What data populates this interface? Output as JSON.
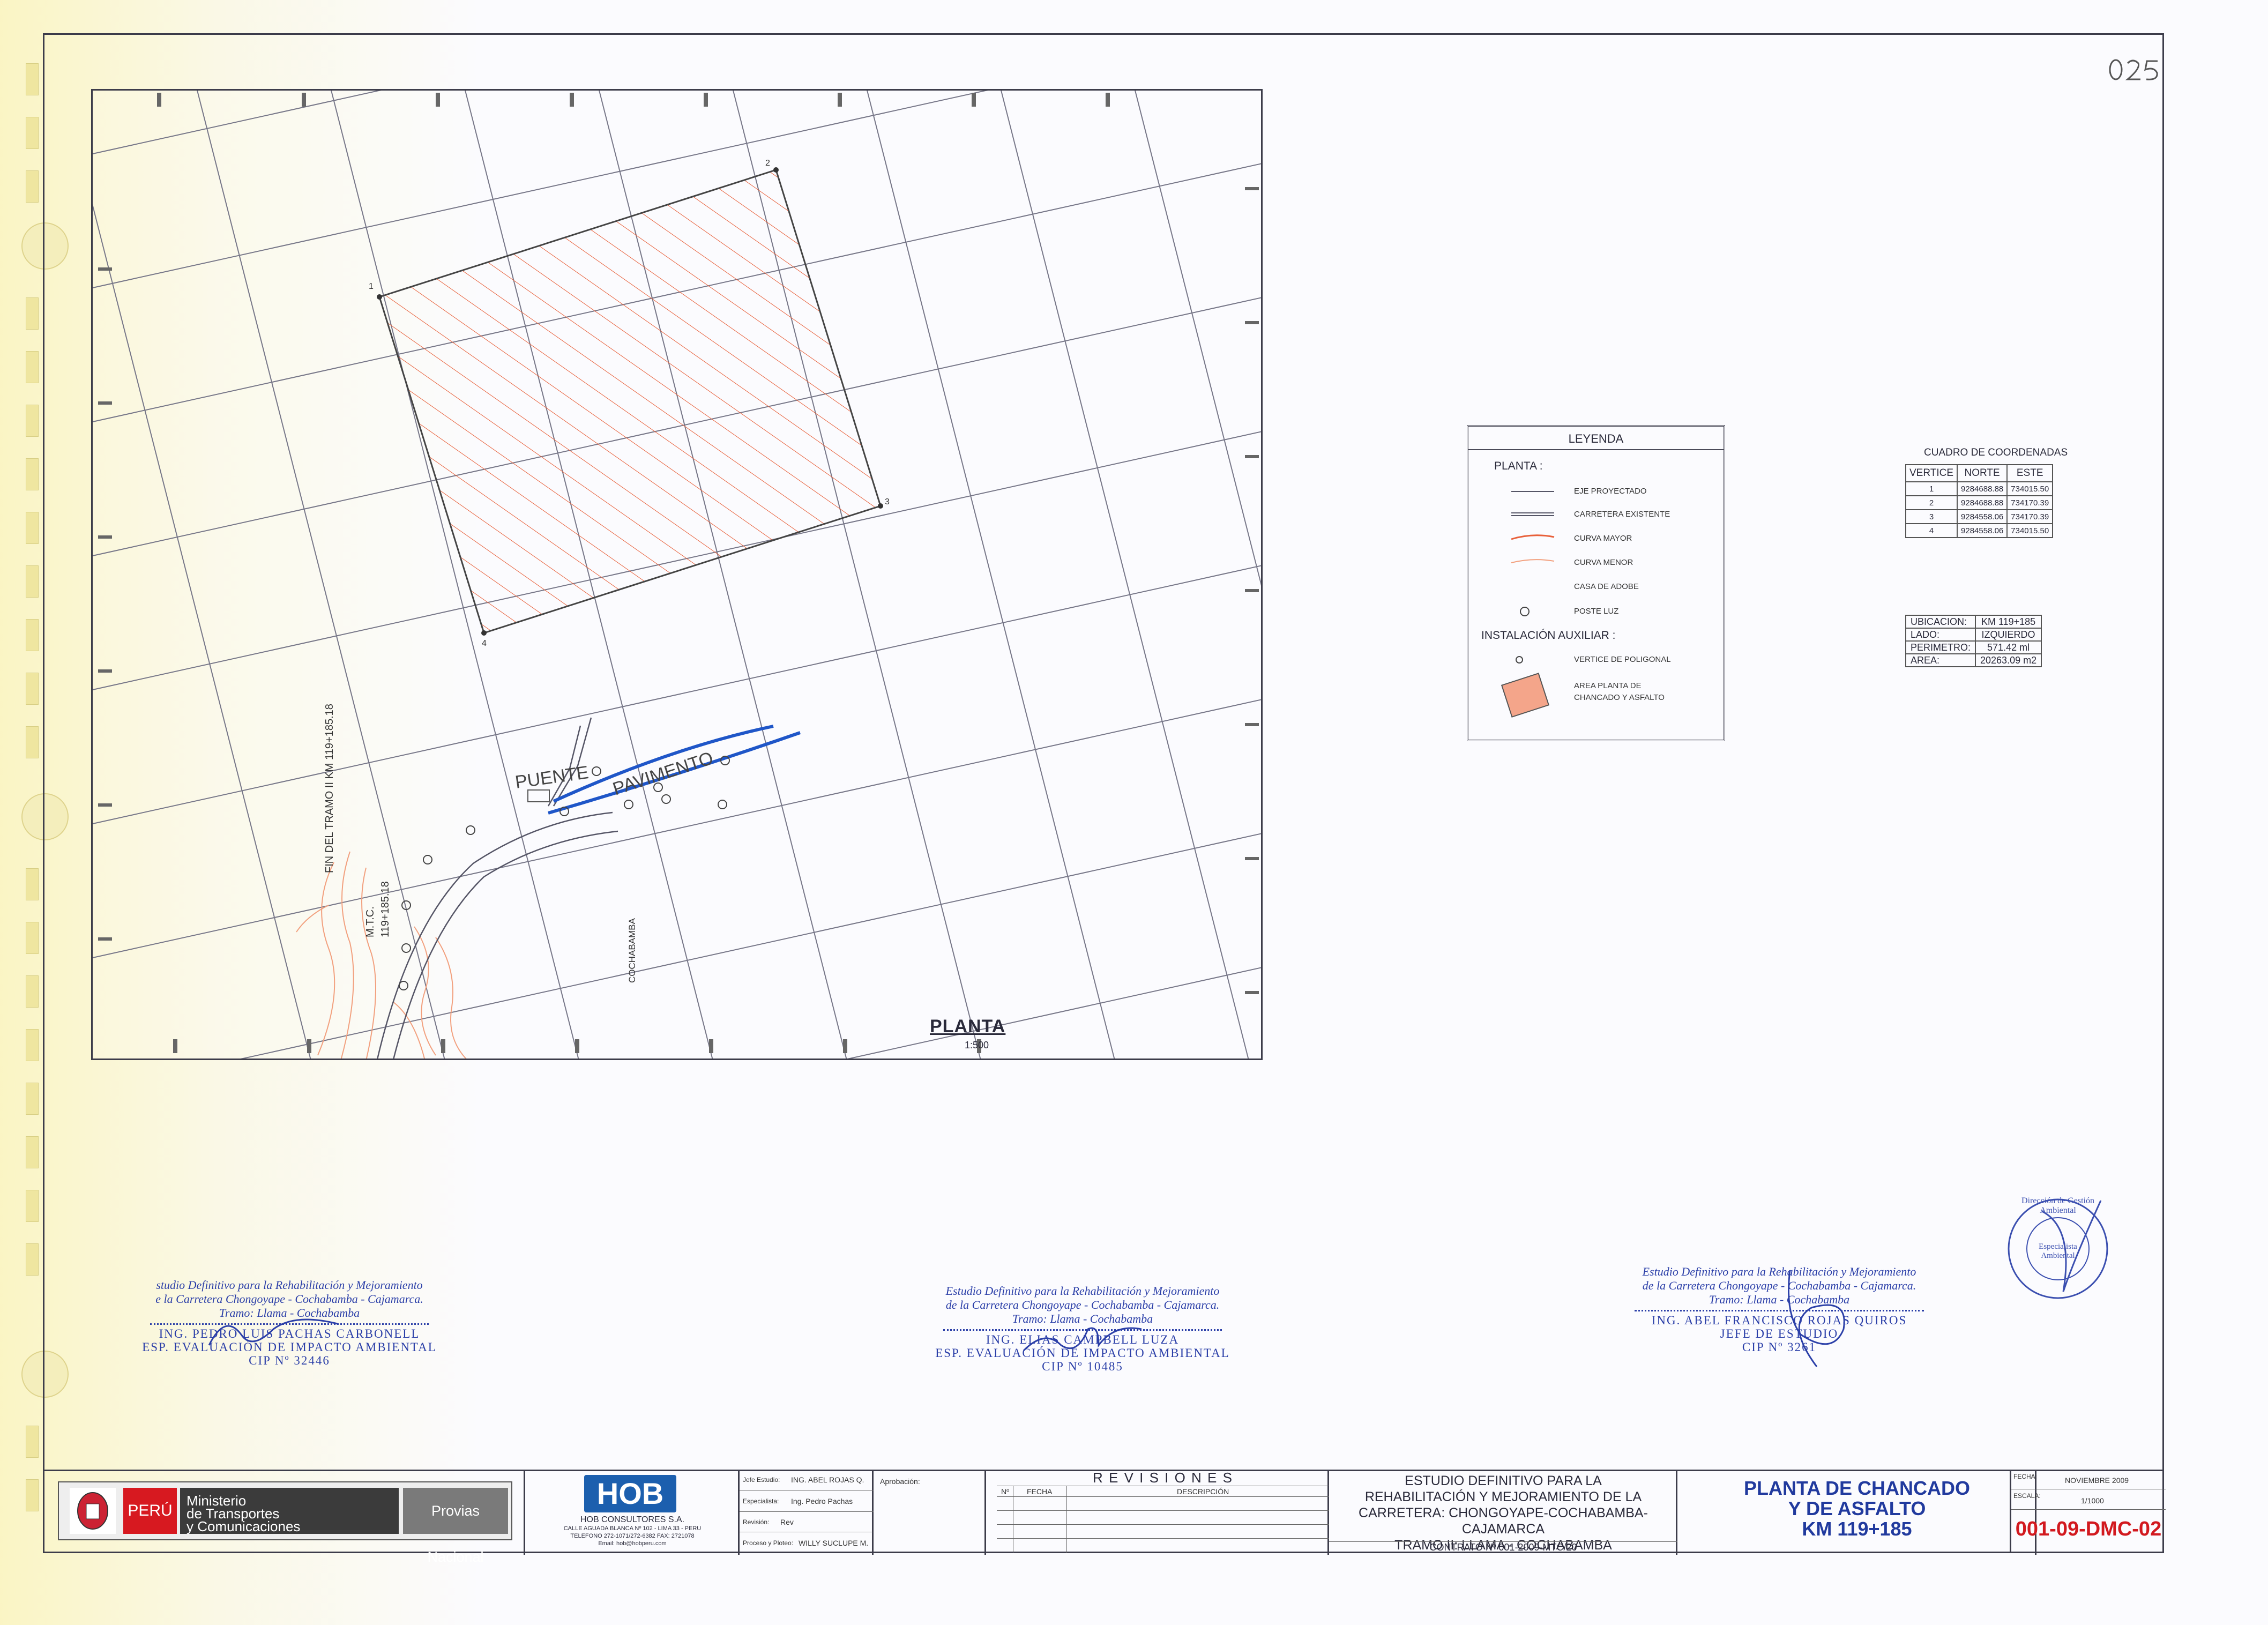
{
  "sheet_number": "",
  "plan": {
    "title": "PLANTA",
    "scale": "1:500",
    "vertex_labels": [
      "1",
      "2",
      "3",
      "4"
    ],
    "station_label": "FIN DEL TRAMO II KM 119+185.18",
    "mtc_label": "M.T.C.",
    "mtc_km": "119+185.18",
    "bridge_label": "PUENTE",
    "pavement_label": "PAVIMENTO",
    "road_label": "COCHABAMBA"
  },
  "legend": {
    "title": "LEYENDA",
    "section_plan": "PLANTA :",
    "items": [
      "EJE PROYECTADO",
      "CARRETERA EXISTENTE",
      "CURVA MAYOR",
      "CURVA MENOR",
      "CASA DE ADOBE",
      "POSTE LUZ"
    ],
    "section_aux": "INSTALACIÓN AUXILIAR :",
    "vertex_item": "VERTICE DE POLIGONAL",
    "area_item_1": "AREA PLANTA DE",
    "area_item_2": "CHANCADO Y ASFALTO",
    "colors": {
      "curva_mayor": "#e8603a",
      "curva_menor": "#f2a07e",
      "area_fill": "#f4a58a",
      "eje": "#555566"
    }
  },
  "coordinates": {
    "title": "CUADRO DE COORDENADAS",
    "headers": [
      "VERTICE",
      "NORTE",
      "ESTE"
    ],
    "rows": [
      [
        "1",
        "9284688.88",
        "734015.50"
      ],
      [
        "2",
        "9284688.88",
        "734170.39"
      ],
      [
        "3",
        "9284558.06",
        "734170.39"
      ],
      [
        "4",
        "9284558.06",
        "734015.50"
      ]
    ]
  },
  "info": {
    "rows": [
      [
        "UBICACION:",
        "KM 119+185"
      ],
      [
        "LADO:",
        "IZQUIERDO"
      ],
      [
        "PERIMETRO:",
        "571.42  ml"
      ],
      [
        "AREA:",
        "20263.09  m2"
      ]
    ]
  },
  "signatures": [
    {
      "line1": "studio Definitivo para la Rehabilitación y Mejoramiento",
      "line2": "e la Carretera Chongoyape - Cochabamba - Cajamarca.",
      "line3": "Tramo: Llama - Cochabamba",
      "name": "ING. PEDRO LUIS PACHAS CARBONELL",
      "role": "ESP. EVALUACIÓN DE IMPACTO AMBIENTAL",
      "cip": "CIP Nº 32446"
    },
    {
      "line1": "Estudio Definitivo para la Rehabilitación y Mejoramiento",
      "line2": "de la Carretera Chongoyape - Cochabamba - Cajamarca.",
      "line3": "Tramo: Llama - Cochabamba",
      "name": "ING. ELIAS CAMPBELL LUZA",
      "role": "ESP. EVALUACIÓN DE IMPACTO AMBIENTAL",
      "cip": "CIP Nº 10485"
    },
    {
      "line1": "Estudio Definitivo para la Rehabilitación y Mejoramiento",
      "line2": "de la Carretera Chongoyape - Cochabamba - Cajamarca.",
      "line3": "Tramo: Llama - Cochabamba",
      "name": "ING. ABEL FRANCISCO ROJAS QUIROS",
      "role": "JEFE DE ESTUDIO",
      "cip": "CIP Nº 3261"
    }
  ],
  "stamp": {
    "text": "Dirección de Gestión Ambiental",
    "center": "Especialista Ambiental"
  },
  "title_block": {
    "peru": "PERÚ",
    "ministry": [
      "Ministerio",
      "de Transportes",
      "y Comunicaciones"
    ],
    "provias": "Provias Nacional",
    "hob_logo": "HOB",
    "hob_name": "HOB CONSULTORES S.A.",
    "hob_addr": "CALLE AGUADA BLANCA Nº 102 - LIMA 33 - PERU",
    "hob_phone": "TELEFONO 272-1071/272-6382 FAX: 2721078",
    "hob_email": "Email: hob@hobperu.com",
    "staff": [
      {
        "label": "Jefe Estudio:",
        "value": "ING. ABEL ROJAS Q."
      },
      {
        "label": "Especialista:",
        "value": "Ing. Pedro Pachas"
      },
      {
        "label": "Revisión:",
        "value": "Rev"
      },
      {
        "label": "Proceso y Ploteo:",
        "value": "WILLY SUCLUPE M."
      }
    ],
    "approval": "Aprobación:",
    "revisions_title": "R E V I S I O N E S",
    "rev_headers": [
      "Nº",
      "FECHA",
      "DESCRIPCIÓN"
    ],
    "project": [
      "ESTUDIO DEFINITIVO PARA LA",
      "REHABILITACIÓN Y MEJORAMIENTO DE LA",
      "CARRETERA: CHONGOYAPE-COCHABAMBA-CAJAMARCA",
      "TRAMO II: LLAMA - COCHABAMBA"
    ],
    "contract": "CONTRATO Nº 001-2009-MTC/20",
    "drawing_title": [
      "PLANTA DE CHANCADO",
      "Y  DE ASFALTO",
      "KM 119+185"
    ],
    "date_label": "FECHA:",
    "date_value": "NOVIEMBRE 2009",
    "scale_label": "ESCALA:",
    "scale_value": "1/1000",
    "drawing_code": "001-09-DMC-02"
  }
}
